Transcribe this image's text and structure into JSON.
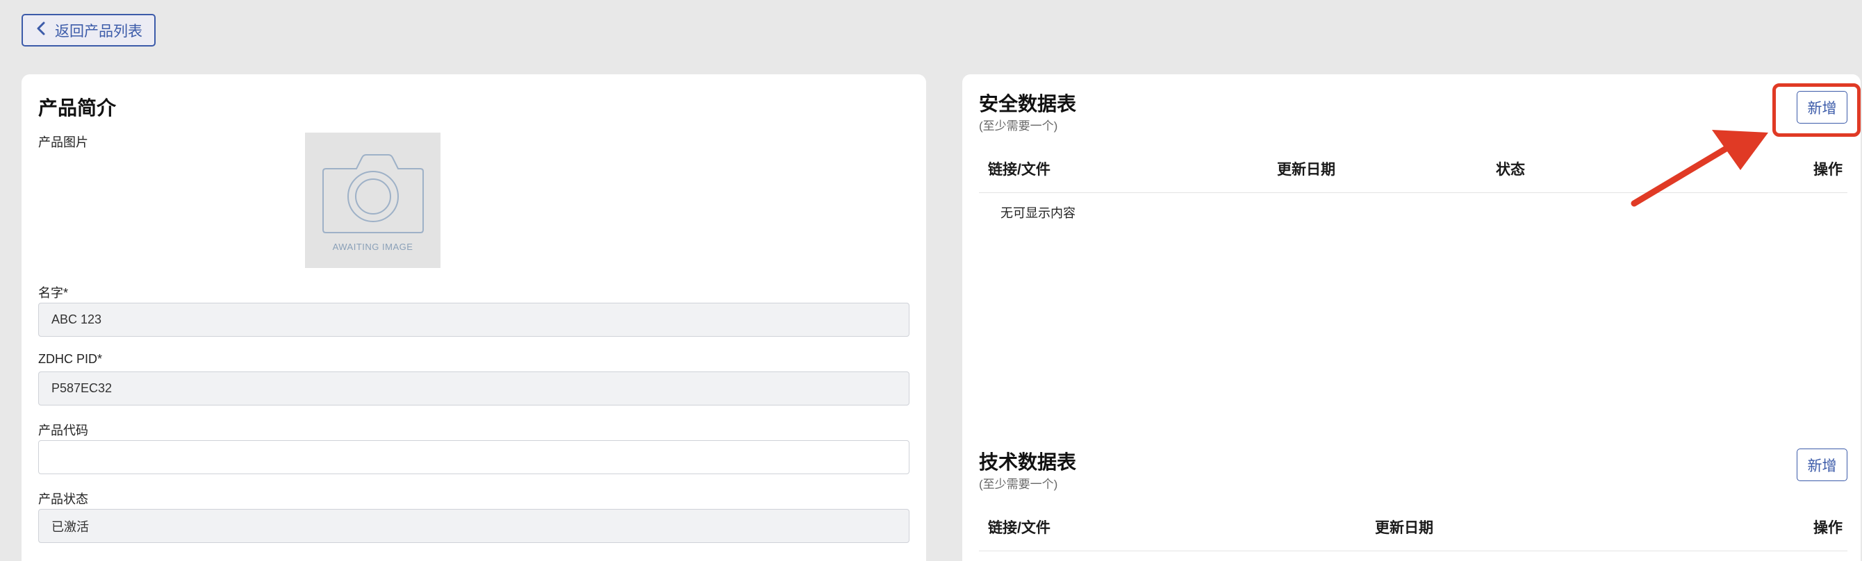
{
  "back_button": {
    "label": "返回产品列表"
  },
  "product_intro": {
    "title": "产品简介",
    "image_label": "产品图片",
    "image_placeholder": "AWAITING IMAGE",
    "fields": [
      {
        "label": "名字*",
        "value": "ABC 123"
      },
      {
        "label": "ZDHC PID*",
        "value": "P587EC32"
      },
      {
        "label": "产品代码",
        "value": ""
      },
      {
        "label": "产品状态",
        "value": "已激活"
      }
    ]
  },
  "safety_sheet": {
    "title": "安全数据表",
    "subtitle": "(至少需要一个)",
    "add_label": "新增",
    "columns": [
      "链接/文件",
      "更新日期",
      "状态",
      "操作"
    ],
    "empty_text": "无可显示内容"
  },
  "tech_sheet": {
    "title": "技术数据表",
    "subtitle": "(至少需要一个)",
    "add_label": "新增",
    "columns": [
      "链接/文件",
      "更新日期",
      "操作"
    ]
  },
  "colors": {
    "accent": "#3c5ba9",
    "annotation": "#e03a25",
    "background": "#e8e8e8"
  },
  "icons": [
    "chevron-left-icon",
    "camera-icon",
    "annotation-arrow-icon"
  ]
}
